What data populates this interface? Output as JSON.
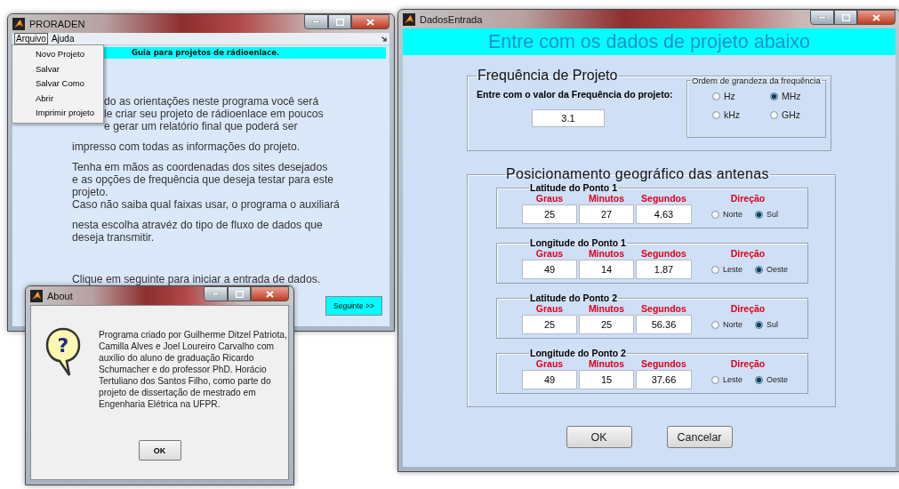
{
  "main_window": {
    "title": "PRORADEN",
    "menu_bar": [
      {
        "label": "Arquivo",
        "selected": true
      },
      {
        "label": "Ajuda",
        "selected": false
      }
    ],
    "menu_items": [
      "Novo Projeto",
      "Salvar",
      "Salvar Como",
      "Abrir",
      "Imprimir projeto"
    ],
    "header": "Guia para projetos de rádioenlace.",
    "paragraphs": [
      {
        "kind": "partly_covered",
        "lines": [
          "do as orientações neste programa você será",
          "le criar seu projeto de rádioenlace em poucos",
          "e gerar um relatório final que poderá ser"
        ]
      },
      {
        "kind": "plain",
        "lines": [
          "impresso com todas as informações do projeto."
        ]
      },
      {
        "kind": "plain",
        "lines": [
          "Tenha em mãos as coordenadas dos sites desejados",
          "e as opções de frequência que deseja testar para este",
          "projeto.",
          "Caso não saiba qual faixas usar, o programa o auxiliará"
        ]
      },
      {
        "kind": "plain",
        "lines": [
          "nesta escolha atravéz do tipo de fluxo de dados que",
          "deseja transmitir."
        ]
      },
      {
        "kind": "final",
        "lines": [
          "Clique em seguinte para iniciar a entrada de dados."
        ]
      }
    ],
    "next_button": "Seguinte >>"
  },
  "about_dialog": {
    "title": "About",
    "icon_glyph": "?",
    "text_lines": [
      "Programa criado por Guilherme Ditzel Patriota,",
      "Camilla Alves e  Joel Loureiro Carvalho com",
      "auxílio do aluno de graduação Ricardo",
      "Schumacher e do professor PhD. Horácio",
      "Tertuliano dos Santos Filho, como parte do",
      "projeto de dissertação de mestrado em",
      "Engenharia Elétrica na UFPR."
    ],
    "ok_button": "OK"
  },
  "data_window": {
    "title": "DadosEntrada",
    "header": "Entre com os dados de projeto abaixo",
    "frequency_group": {
      "title": "Frequência de Projeto",
      "label": "Entre com o valor da Frequência do projeto:",
      "value": "3.1",
      "unit_group": {
        "title": "Ordem de grandeza da frequência",
        "options": [
          {
            "label": "Hz",
            "selected": false
          },
          {
            "label": "MHz",
            "selected": true
          },
          {
            "label": "kHz",
            "selected": false
          },
          {
            "label": "GHz",
            "selected": false
          }
        ]
      }
    },
    "position_group": {
      "title": "Posicionamento geográfico das antenas",
      "points": [
        {
          "title": "Latitude do Ponto 1",
          "headers": [
            "Graus",
            "Minutos",
            "Segundos",
            "Direção"
          ],
          "values": [
            "25",
            "27",
            "4.63"
          ],
          "directions": [
            {
              "label": "Norte",
              "selected": false
            },
            {
              "label": "Sul",
              "selected": true
            }
          ]
        },
        {
          "title": "Longitude do Ponto 1",
          "headers": [
            "Graus",
            "Minutos",
            "Segundos",
            "Direção"
          ],
          "values": [
            "49",
            "14",
            "1.87"
          ],
          "directions": [
            {
              "label": "Leste",
              "selected": false
            },
            {
              "label": "Oeste",
              "selected": true
            }
          ]
        },
        {
          "title": "Latitude do Ponto 2",
          "headers": [
            "Graus",
            "Minutos",
            "Segundos",
            "Direção"
          ],
          "values": [
            "25",
            "25",
            "56.36"
          ],
          "directions": [
            {
              "label": "Norte",
              "selected": false
            },
            {
              "label": "Sul",
              "selected": true
            }
          ]
        },
        {
          "title": "Longitude do Ponto 2",
          "headers": [
            "Graus",
            "Minutos",
            "Segundos",
            "Direção"
          ],
          "values": [
            "49",
            "15",
            "37.66"
          ],
          "directions": [
            {
              "label": "Leste",
              "selected": false
            },
            {
              "label": "Oeste",
              "selected": true
            }
          ]
        }
      ]
    },
    "buttons": [
      "OK",
      "Cancelar"
    ]
  }
}
